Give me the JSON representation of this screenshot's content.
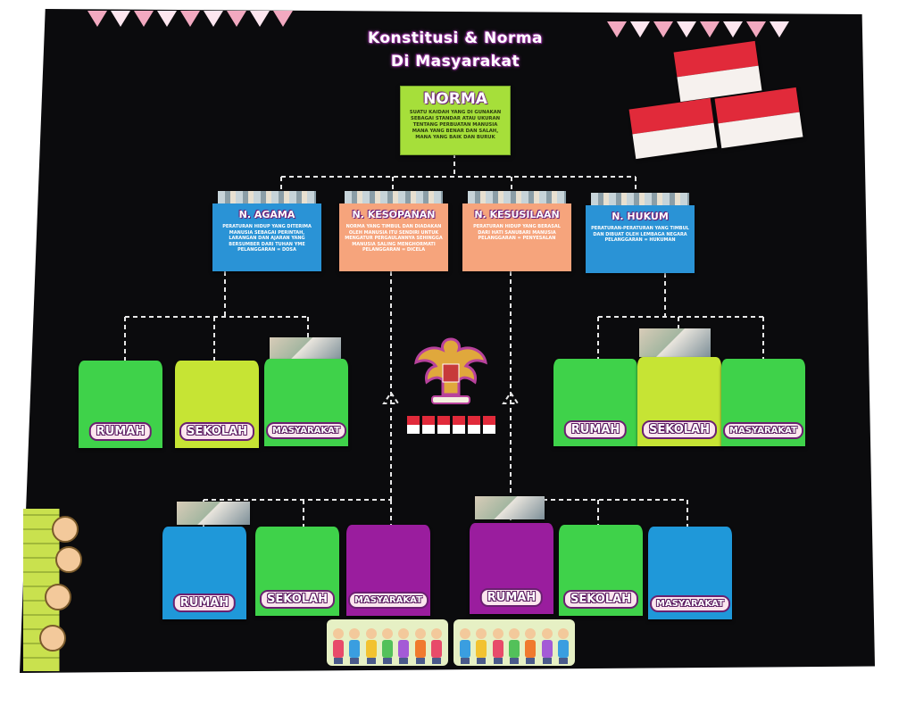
{
  "title": {
    "line1": "Konstitusi & Norma",
    "line2": "Di Masyarakat"
  },
  "root": {
    "label": "NORMA",
    "description": "SUATU KAIDAH YANG DI GUNAKAN SEBAGAI STANDAR ATAU UKURAN TENTANG PERBUATAN MANUSIA MANA YANG BENAR DAN SALAH, MANA YANG BAIK DAN BURUK"
  },
  "categories": [
    {
      "label": "N. AGAMA",
      "color": "#2a93d6",
      "description": "PERATURAN HIDUP YANG DITERIMA MANUSIA SEBAGAI PERINTAH, LARANGAN DAN AJARAN YANG BERSUMBER DARI TUHAN YME PELANGGARAN = DOSA"
    },
    {
      "label": "N. KESOPANAN",
      "color": "#f6a47c",
      "description": "NORMA YANG TIMBUL DAN DIADAKAN OLEH MANUSIA ITU SENDIRI UNTUK MENGATUR PERGAULANNYA SEHINGGA MANUSIA SALING MENGHORMATI PELANGGARAN = DICELA"
    },
    {
      "label": "N. KESUSILAAN",
      "color": "#f6a47c",
      "description": "PERATURAN HIDUP YANG BERASAL DARI HATI SANUBARI MANUSIA PELANGGARAN = PENYESALAN"
    },
    {
      "label": "N. HUKUM",
      "color": "#2a93d6",
      "description": "PERATURAN-PERATURAN YANG TIMBUL DAN DIBUAT OLEH LEMBAGA NEGARA PELANGGARAN = HUKUMAN"
    }
  ],
  "pockets_mid_left": [
    {
      "label": "RUMAH",
      "color": "green"
    },
    {
      "label": "SEKOLAH",
      "color": "lime"
    },
    {
      "label": "MASYARAKAT",
      "color": "green"
    }
  ],
  "pockets_mid_right": [
    {
      "label": "RUMAH",
      "color": "green"
    },
    {
      "label": "SEKOLAH",
      "color": "lime"
    },
    {
      "label": "MASYARAKAT",
      "color": "green"
    }
  ],
  "pockets_bottom_left": [
    {
      "label": "RUMAH",
      "color": "blue"
    },
    {
      "label": "SEKOLAH",
      "color": "green"
    },
    {
      "label": "MASYARAKAT",
      "color": "purple"
    }
  ],
  "pockets_bottom_right": [
    {
      "label": "RUMAH",
      "color": "purple"
    },
    {
      "label": "SEKOLAH",
      "color": "green"
    },
    {
      "label": "MASYARAKAT",
      "color": "blue"
    }
  ],
  "colors": {
    "board": "#0b0b0d",
    "flag_red": "#e12a3a",
    "flag_white": "#f6f1ee",
    "label_outline": "#6a2070"
  }
}
